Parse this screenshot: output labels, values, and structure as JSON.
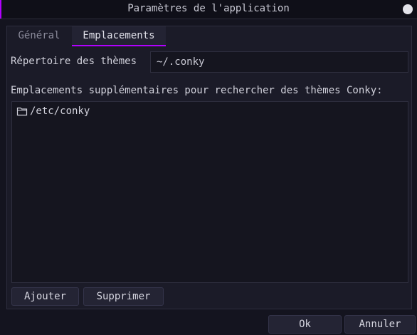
{
  "window": {
    "title": "Paramètres de l'application"
  },
  "tabs": [
    {
      "label": "Général",
      "active": false
    },
    {
      "label": "Emplacements",
      "active": true
    }
  ],
  "themes_dir": {
    "label": "Répertoire des thèmes",
    "value": "~/.conky"
  },
  "extra_locations": {
    "label": "Emplacements supplémentaires pour rechercher des thèmes Conky:",
    "items": [
      {
        "icon": "folder-icon",
        "path": "/etc/conky"
      }
    ]
  },
  "list_buttons": {
    "add": "Ajouter",
    "remove": "Supprimer"
  },
  "dialog_buttons": {
    "ok": "Ok",
    "cancel": "Annuler"
  },
  "colors": {
    "accent": "#b100ff",
    "background": "#14141f",
    "panel": "#1b1b28"
  }
}
